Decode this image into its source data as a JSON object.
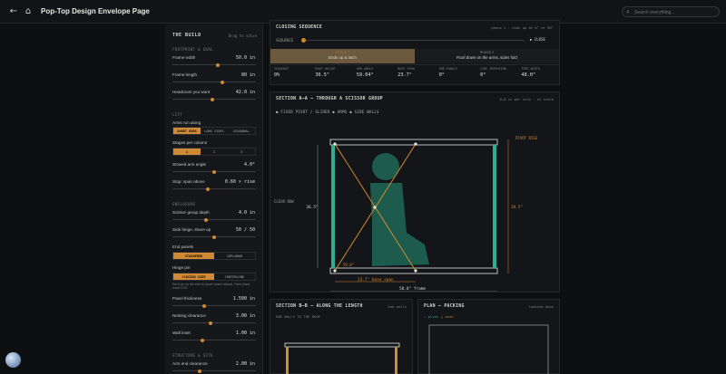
{
  "header": {
    "title": "Pop-Top Design Envelope Page",
    "search_placeholder": "Search everything..."
  },
  "build": {
    "title": "THE BUILD",
    "aside": "Drag to solve",
    "footprint_label": "FOOTPRINT & GOAL",
    "frame_width": {
      "label": "Frame width",
      "value": "50.0 in",
      "level": 0.55
    },
    "frame_length": {
      "label": "Frame length",
      "value": "80 in",
      "level": 0.6
    },
    "headroom": {
      "label": "Headroom you want",
      "value": "42.0 in",
      "level": 0.48
    },
    "lift_label": "LIFT",
    "arms_run_along": {
      "label": "Arms run along",
      "options": [
        "SHORT ENDS",
        "LONG SIDES",
        "DIAGONAL"
      ],
      "selected": 0
    },
    "stages": {
      "label": "Stages per column",
      "options": [
        "1",
        "2",
        "3"
      ],
      "selected": 0
    },
    "stowed_angle": {
      "label": "Stowed arm angle",
      "value": "4.0°",
      "level": 0.5
    },
    "stop": {
      "label": "Stop: span above",
      "value": "0.60 × rise",
      "level": 0.42
    },
    "enclosure_label": "ENCLOSURE",
    "scissor_depth": {
      "label": "Scissor group depth",
      "value": "4.0 in",
      "level": 0.4
    },
    "side_hinge": {
      "label": "Side hinge, share up",
      "value": "50 / 50",
      "level": 0.5
    },
    "end_panels": {
      "label": "End panels",
      "options": [
        "STAGGERED",
        "COPLANAR"
      ],
      "selected": 0
    },
    "hinge_pin": {
      "label": "Hinge pin",
      "options": [
        "CLOSING SIDE",
        "CENTERLINE"
      ],
      "selected": 0
    },
    "hinge_note": "Each pin on the side its panel closes toward. Fixed plane reach 0.00\"",
    "panel_thickness": {
      "label": "Panel thickness",
      "value": "1.500 in",
      "level": 0.38
    },
    "nesting_clearance": {
      "label": "Nesting clearance",
      "value": "3.00 in",
      "level": 0.45
    },
    "wall_inset": {
      "label": "Wall inset",
      "value": "1.00 in",
      "level": 0.35
    },
    "structure_label": "STRUCTURE & SITE",
    "arm_end_clearance": {
      "label": "Arm end clearance",
      "value": "2.00 in",
      "level": 0.32
    }
  },
  "closing": {
    "title": "CLOSING SEQUENCE",
    "right": "phase 1 · ends up at 0° of 90°",
    "sequence_label": "SEQUENCE",
    "close_button": "CLOSE",
    "progress": 0.0,
    "phase1": {
      "name": "PHASE 1",
      "text": "Ends up & latch"
    },
    "phase2": {
      "name": "PHASE 2",
      "text": "Roof down on the arms, sides fold"
    },
    "stats": [
      {
        "k": "SEQUENCE",
        "v": "0%"
      },
      {
        "k": "ROOF HEIGHT",
        "v": "36.5\""
      },
      {
        "k": "ARM ANGLE",
        "v": "59.04°"
      },
      {
        "k": "BASE SPAN",
        "v": "23.7\""
      },
      {
        "k": "END PANELS",
        "v": "0°"
      },
      {
        "k": "SIDE INTRUSION",
        "v": "0°"
      },
      {
        "k": "FREE WIDTH",
        "v": "48.0\""
      }
    ]
  },
  "section_a": {
    "title": "SECTION A–A — THROUGH A SCISSOR GROUP",
    "right": "0–0 in per inch · to scale",
    "legend": "● FIXED PIVOT / SLIDER ● ARMS ● SIDE WALLS",
    "clear_label": "CLEAR NOW",
    "pivot_label": "PIVOT RISE",
    "height_left": "36.5\"",
    "height_right": "39.5\"",
    "angle": "59.0°",
    "base_span": "23.7\" base span",
    "frame": "50.0\" frame"
  },
  "section_b": {
    "title": "SECTION B–B — ALONG THE LENGTH",
    "right": "end walls",
    "sub": "END WALLS TO THE ROOF"
  },
  "plan": {
    "title": "PLAN — PACKING",
    "right": "looking down",
    "legend_a": "◌ pivot",
    "legend_b": "▢ ends"
  },
  "colors": {
    "accent": "#d08a34",
    "teal": "#2fae96",
    "figure": "#1f6b58"
  }
}
